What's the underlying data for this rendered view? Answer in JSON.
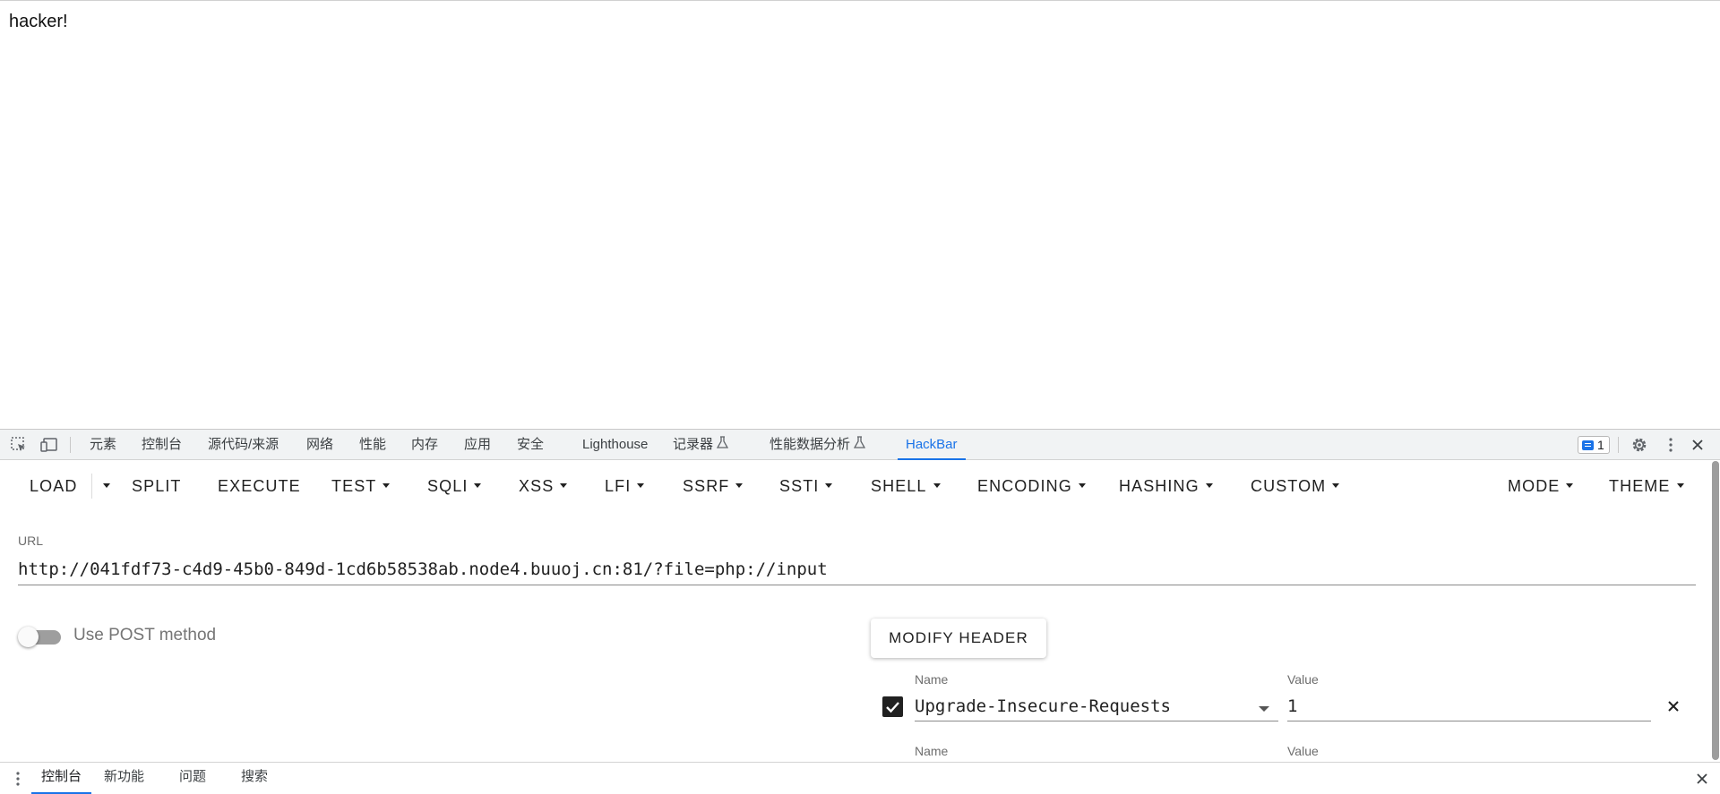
{
  "page": {
    "text": "hacker!"
  },
  "devtools": {
    "tabs": [
      {
        "label": "元素"
      },
      {
        "label": "控制台"
      },
      {
        "label": "源代码/来源"
      },
      {
        "label": "网络"
      },
      {
        "label": "性能"
      },
      {
        "label": "内存"
      },
      {
        "label": "应用"
      },
      {
        "label": "安全"
      },
      {
        "label": "Lighthouse"
      },
      {
        "label": "记录器",
        "flask": "Ⅰ"
      },
      {
        "label": "性能数据分析",
        "flask": "Ⅰ"
      },
      {
        "label": "HackBar",
        "active": true
      }
    ],
    "issues_count": "1"
  },
  "hackbar": {
    "toolbar": {
      "load": "LOAD",
      "split": "SPLIT",
      "execute": "EXECUTE",
      "test": "TEST",
      "sqli": "SQLI",
      "xss": "XSS",
      "lfi": "LFI",
      "ssrf": "SSRF",
      "ssti": "SSTI",
      "shell": "SHELL",
      "encoding": "ENCODING",
      "hashing": "HASHING",
      "custom": "CUSTOM",
      "mode": "MODE",
      "theme": "THEME"
    },
    "url": {
      "label": "URL",
      "value": "http://041fdf73-c4d9-45b0-849d-1cd6b58538ab.node4.buuoj.cn:81/?file=php://input"
    },
    "post": {
      "label": "Use POST method",
      "enabled": false
    },
    "modify_header_label": "MODIFY HEADER",
    "headers": [
      {
        "name_label": "Name",
        "value_label": "Value",
        "name": "Upgrade-Insecure-Requests",
        "value": "1",
        "checked": true
      },
      {
        "name_label": "Name",
        "value_label": "Value"
      }
    ]
  },
  "drawer": {
    "tabs": [
      {
        "label": "控制台",
        "active": true
      },
      {
        "label": "新功能"
      },
      {
        "label": "问题"
      },
      {
        "label": "搜索"
      }
    ]
  },
  "colors": {
    "accent": "#1a73e8"
  }
}
